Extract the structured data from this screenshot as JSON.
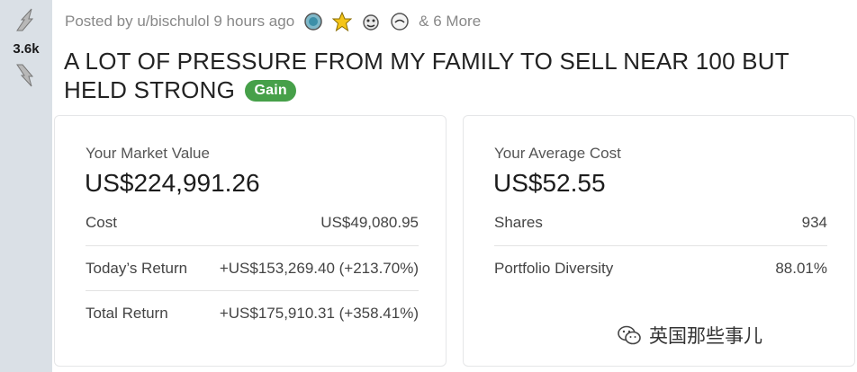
{
  "vote": {
    "count": "3.6k"
  },
  "post": {
    "meta_text": "Posted by u/bischulol 9 hours ago",
    "awards": [
      "award-icon-1",
      "award-icon-2",
      "award-icon-3",
      "award-icon-4"
    ],
    "more_awards": "& 6 More",
    "title": "A LOT OF PRESSURE FROM MY FAMILY TO SELL NEAR 100 BUT HELD STRONG",
    "flair": "Gain",
    "flair_color": "#46a049"
  },
  "market_card": {
    "label": "Your Market Value",
    "value": "US$224,991.26",
    "rows": [
      {
        "label": "Cost",
        "value": "US$49,080.95"
      },
      {
        "label": "Today’s Return",
        "value": "+US$153,269.40 (+213.70%)"
      },
      {
        "label": "Total Return",
        "value": "+US$175,910.31 (+358.41%)"
      }
    ]
  },
  "avg_card": {
    "label": "Your Average Cost",
    "value": "US$52.55",
    "rows": [
      {
        "label": "Shares",
        "value": "934"
      },
      {
        "label": "Portfolio Diversity",
        "value": "88.01%"
      }
    ]
  },
  "watermark": {
    "text": "英国那些事儿"
  }
}
